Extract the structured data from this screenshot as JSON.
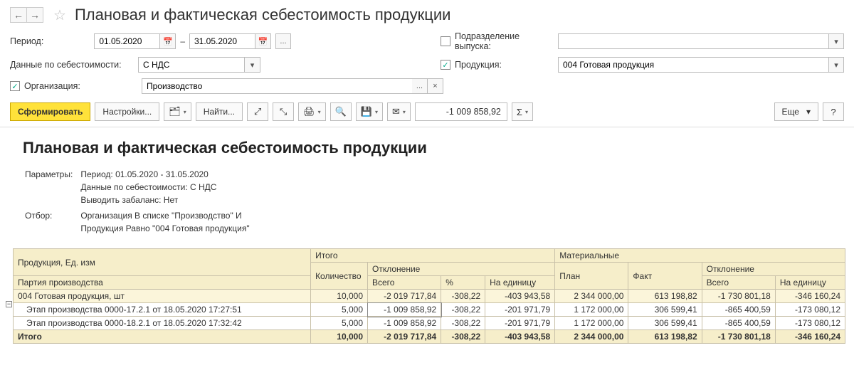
{
  "header": {
    "title": "Плановая и фактическая себестоимость продукции"
  },
  "filters": {
    "period_label": "Период:",
    "date_from": "01.05.2020",
    "date_to": "31.05.2020",
    "dash": "–",
    "dots": "...",
    "unit_label": "Подразделение выпуска:",
    "unit_value": "",
    "cost_label": "Данные по себестоимости:",
    "cost_value": "С НДС",
    "product_label": "Продукция:",
    "product_value": "004 Готовая продукция",
    "org_label": "Организация:",
    "org_value": "Производство"
  },
  "toolbar": {
    "form": "Сформировать",
    "settings": "Настройки...",
    "find": "Найти...",
    "value_readout": "-1 009 858,92",
    "more": "Еще",
    "sigma": "Σ"
  },
  "report": {
    "title": "Плановая и фактическая себестоимость продукции",
    "params_label": "Параметры:",
    "params_lines": [
      "Период: 01.05.2020 - 31.05.2020",
      "Данные по себестоимости: С НДС",
      "Выводить забаланс: Нет"
    ],
    "filter_label": "Отбор:",
    "filter_lines": [
      "Организация В списке \"Производство\" И",
      "Продукция Равно \"004 Готовая продукция\""
    ],
    "columns": {
      "product": "Продукция, Ед. изм",
      "batch": "Партия производства",
      "total_group": "Итого",
      "qty": "Количество",
      "dev_group": "Отклонение",
      "all": "Всего",
      "pct": "%",
      "per_unit": "На единицу",
      "mat_group": "Материальные",
      "plan": "План",
      "fact": "Факт"
    },
    "rows": [
      {
        "kind": "product",
        "label": "004 Готовая продукция, шт",
        "qty": "10,000",
        "dev_all": "-2 019 717,84",
        "dev_pct": "-308,22",
        "dev_unit": "-403 943,58",
        "plan": "2 344 000,00",
        "fact": "613 198,82",
        "mdev_all": "-1 730 801,18",
        "mdev_unit": "-346 160,24"
      },
      {
        "kind": "stage",
        "label": "Этап производства 0000-17.2.1 от 18.05.2020 17:27:51",
        "qty": "5,000",
        "dev_all": "-1 009 858,92",
        "dev_pct": "-308,22",
        "dev_unit": "-201 971,79",
        "plan": "1 172 000,00",
        "fact": "306 599,41",
        "mdev_all": "-865 400,59",
        "mdev_unit": "-173 080,12"
      },
      {
        "kind": "stage",
        "label": "Этап производства 0000-18.2.1 от 18.05.2020 17:32:42",
        "qty": "5,000",
        "dev_all": "-1 009 858,92",
        "dev_pct": "-308,22",
        "dev_unit": "-201 971,79",
        "plan": "1 172 000,00",
        "fact": "306 599,41",
        "mdev_all": "-865 400,59",
        "mdev_unit": "-173 080,12"
      },
      {
        "kind": "total",
        "label": "Итого",
        "qty": "10,000",
        "dev_all": "-2 019 717,84",
        "dev_pct": "-308,22",
        "dev_unit": "-403 943,58",
        "plan": "2 344 000,00",
        "fact": "613 198,82",
        "mdev_all": "-1 730 801,18",
        "mdev_unit": "-346 160,24"
      }
    ]
  }
}
